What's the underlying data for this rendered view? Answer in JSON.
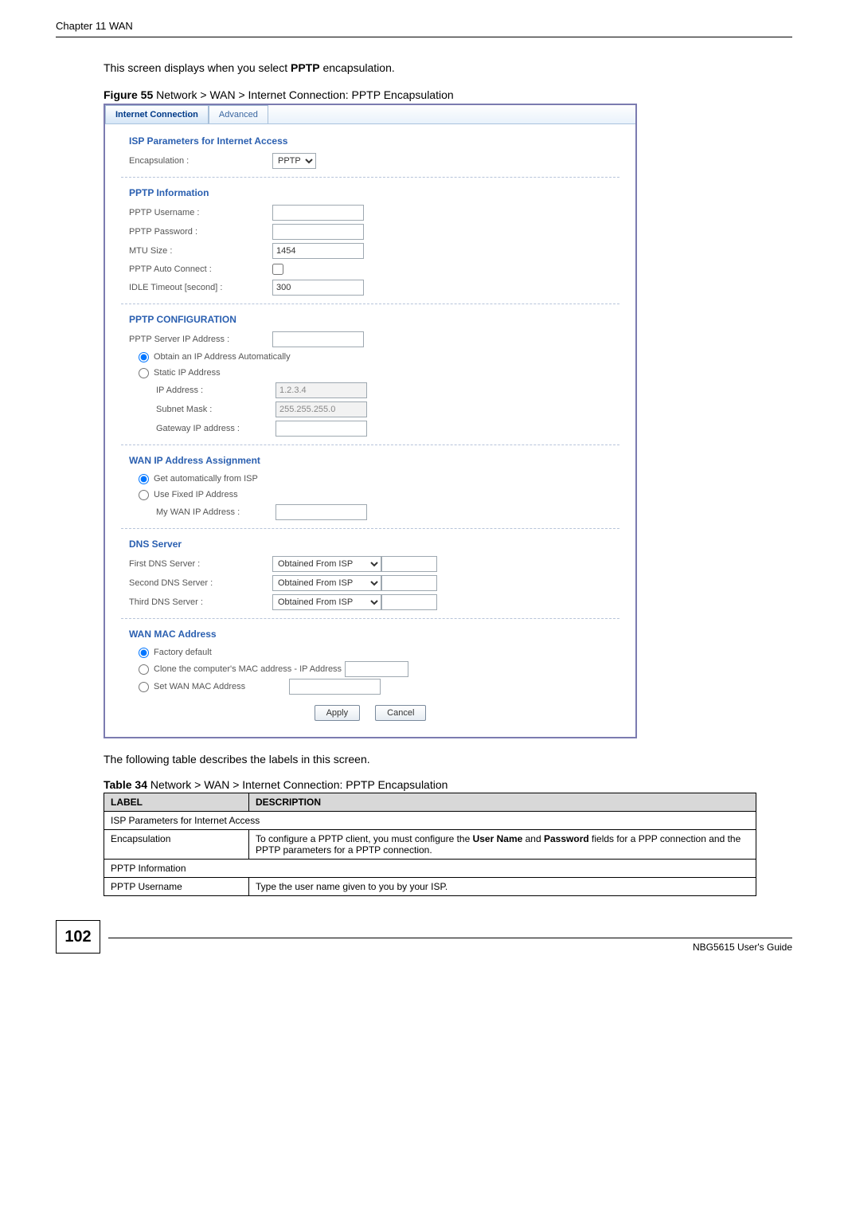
{
  "header": {
    "chapter": "Chapter 11 WAN"
  },
  "body": {
    "intro_before": "This screen displays when you select ",
    "intro_bold": "PPTP",
    "intro_after": " encapsulation.",
    "fig_label": "Figure 55",
    "fig_title": "   Network > WAN > Internet Connection: PPTP Encapsulation",
    "after_fig": "The following table describes the labels in this screen.",
    "tbl_label": "Table 34",
    "tbl_title": "   Network > WAN > Internet Connection: PPTP Encapsulation"
  },
  "ui": {
    "tabs": {
      "active": "Internet Connection",
      "other": "Advanced"
    },
    "s1_title": "ISP Parameters for Internet Access",
    "encap_label": "Encapsulation :",
    "encap_value": "PPTP",
    "s2_title": "PPTP Information",
    "pptp_user_label": "PPTP Username :",
    "pptp_pass_label": "PPTP Password :",
    "mtu_label": "MTU Size :",
    "mtu_value": "1454",
    "auto_label": "PPTP Auto Connect :",
    "idle_label": "IDLE Timeout [second] :",
    "idle_value": "300",
    "s3_title": "PPTP CONFIGURATION",
    "server_ip_label": "PPTP Server IP Address :",
    "radio_obtain": "Obtain an IP Address Automatically",
    "radio_static": "Static IP Address",
    "ip_label": "IP Address :",
    "ip_placeholder": "1.2.3.4",
    "subnet_label": "Subnet Mask :",
    "subnet_placeholder": "255.255.255.0",
    "gw_label": "Gateway IP address :",
    "s4_title": "WAN IP Address Assignment",
    "wan_r1": "Get automatically from ISP",
    "wan_r2": "Use Fixed IP Address",
    "wan_my_label": "My WAN IP Address :",
    "s5_title": "DNS Server",
    "dns1_label": "First DNS Server :",
    "dns2_label": "Second DNS Server :",
    "dns3_label": "Third DNS Server :",
    "dns_opt": "Obtained From ISP",
    "s6_title": "WAN MAC Address",
    "mac_r1": "Factory default",
    "mac_r2": "Clone the computer's MAC address - IP Address",
    "mac_r3": "Set WAN MAC Address",
    "btn_apply": "Apply",
    "btn_cancel": "Cancel"
  },
  "table": {
    "h1": "LABEL",
    "h2": "DESCRIPTION",
    "r1c1": "ISP Parameters for Internet Access",
    "r2c1": "Encapsulation",
    "r2c2a": "To configure a PPTP client, you must configure the ",
    "r2c2b": "User Name",
    "r2c2c": " and ",
    "r2c2d": "Password",
    "r2c2e": " fields for a PPP connection and the PPTP parameters for a PPTP connection.",
    "r3c1": "PPTP Information",
    "r4c1": "PPTP Username",
    "r4c2": "Type the user name given to you by your ISP."
  },
  "footer": {
    "page": "102",
    "guide": "NBG5615 User's Guide"
  }
}
